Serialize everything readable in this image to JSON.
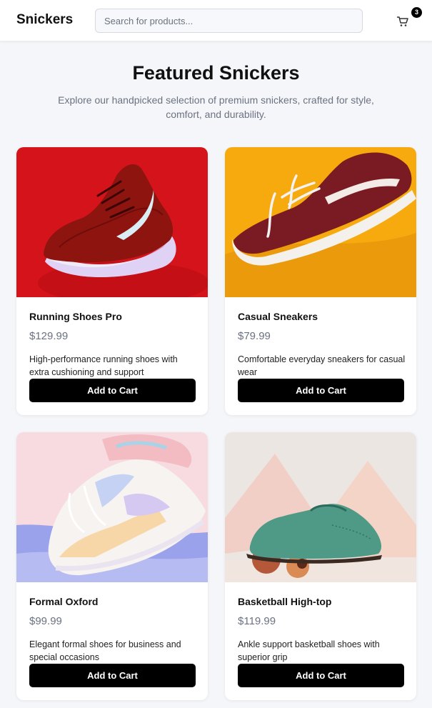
{
  "header": {
    "brand": "Snickers",
    "search_placeholder": "Search for products...",
    "cart_icon": "cart-icon",
    "cart_count": "3"
  },
  "hero": {
    "title": "Featured Snickers",
    "subtitle": "Explore our handpicked selection of premium snickers, crafted for style, comfort, and durability."
  },
  "products": [
    {
      "name": "Running Shoes Pro",
      "price": "$129.99",
      "description": "High-performance running shoes with extra cushioning and support",
      "button": "Add to Cart",
      "image_bg": "#d9141c"
    },
    {
      "name": "Casual Sneakers",
      "price": "$79.99",
      "description": "Comfortable everyday sneakers for casual wear",
      "button": "Add to Cart",
      "image_bg": "#f7ac0f"
    },
    {
      "name": "Formal Oxford",
      "price": "$99.99",
      "description": "Elegant formal shoes for business and special occasions",
      "button": "Add to Cart",
      "image_bg": "#f6d9dd"
    },
    {
      "name": "Basketball High-top",
      "price": "$119.99",
      "description": "Ankle support basketball shoes with superior grip",
      "button": "Add to Cart",
      "image_bg": "#e9e3df"
    }
  ]
}
